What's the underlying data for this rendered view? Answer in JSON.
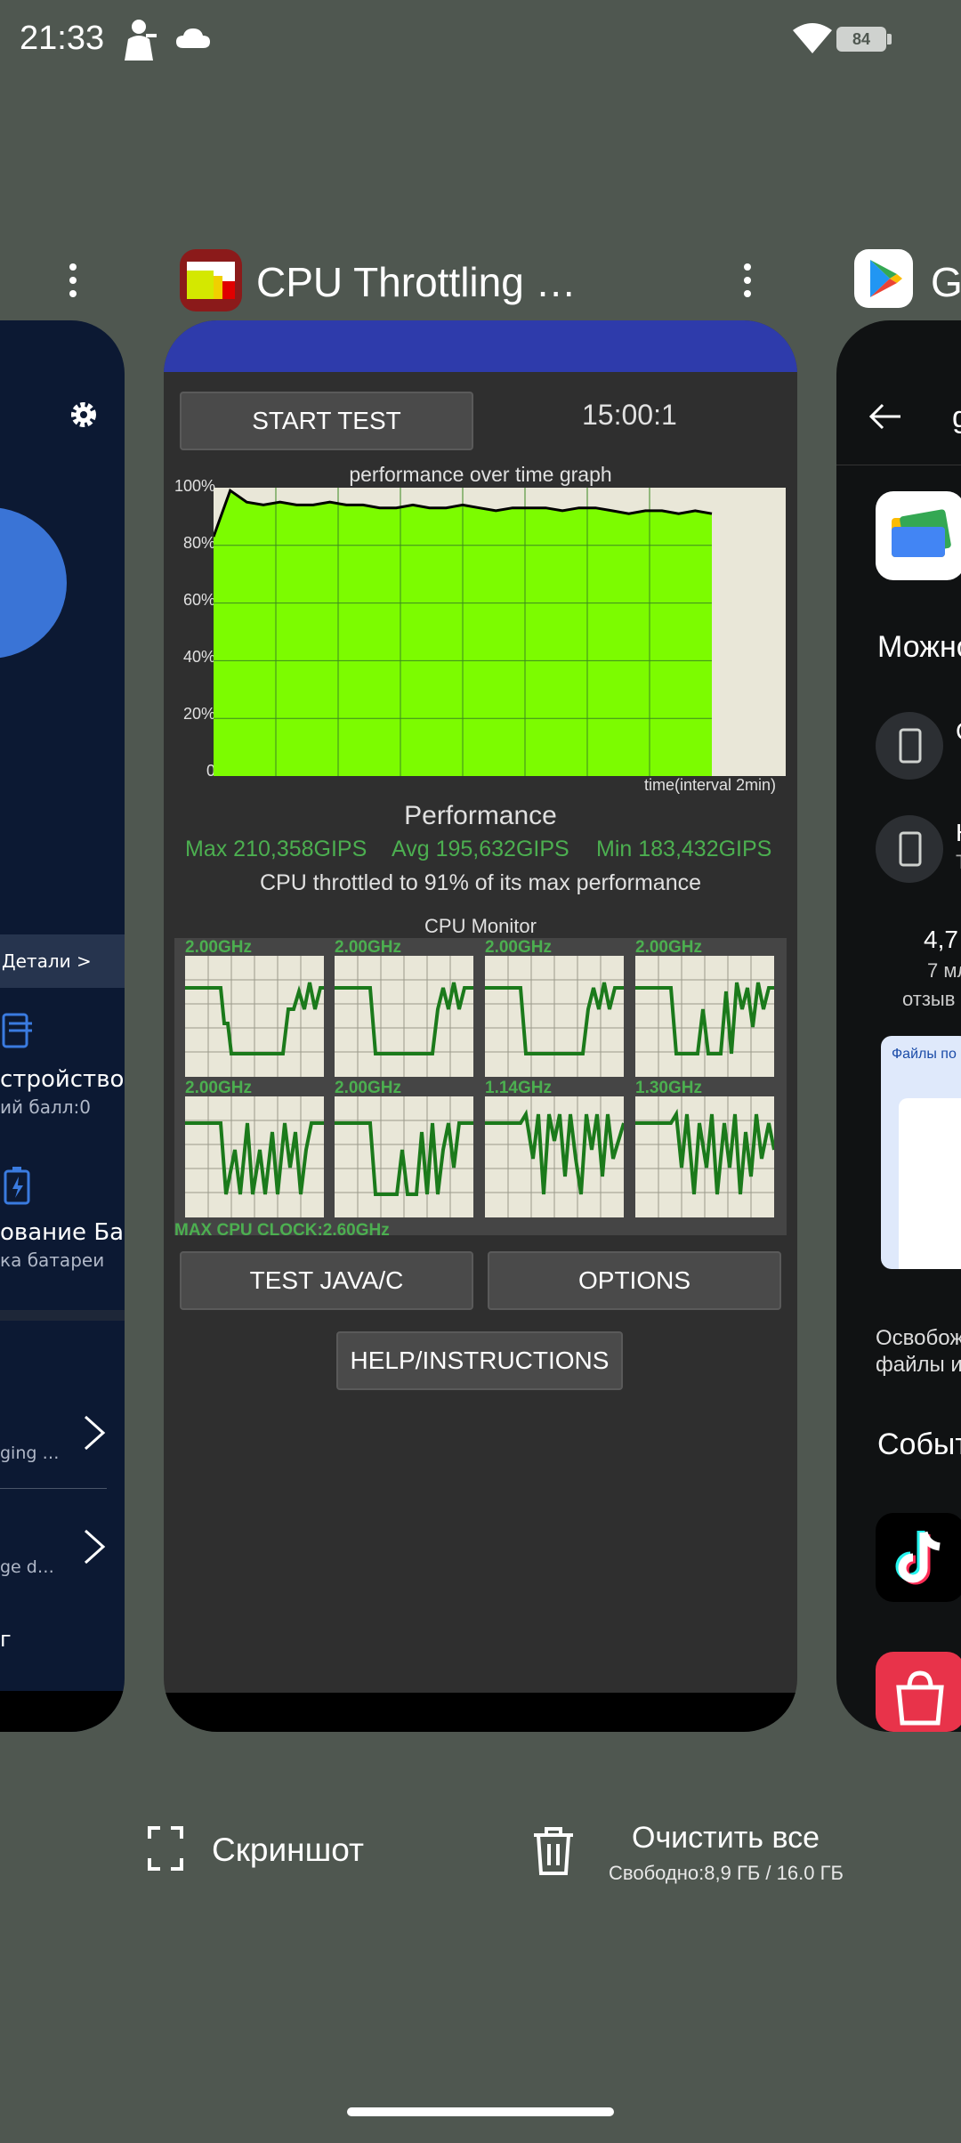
{
  "status_bar": {
    "time": "21:33",
    "battery": "84",
    "icons": [
      "pubg-icon",
      "cloud-icon",
      "wifi-icon",
      "battery-icon"
    ]
  },
  "left_app": {
    "details_label": "Детали >",
    "row1_title": "стройство",
    "row1_sub": "ий балл:0",
    "row2_title": "ование Ба…",
    "row2_sub": "ка батареи",
    "item1_sub": "ging …",
    "item2_sub": "ge d…",
    "item3_label": "г"
  },
  "main_app": {
    "title": "CPU Throttling …",
    "start_button": "START TEST",
    "timer": "15:00:1",
    "graph_title": "performance over time graph",
    "y_labels": [
      "100%",
      "80%",
      "60%",
      "40%",
      "20%",
      "0"
    ],
    "graph_footer": "time(interval 2min)",
    "performance_label": "Performance",
    "max": "Max 210,358GIPS",
    "avg": "Avg 195,632GIPS",
    "min": "Min 183,432GIPS",
    "throttle_text": "CPU throttled to 91% of its max performance",
    "cpu_monitor_title": "CPU Monitor",
    "cores": [
      "2.00GHz",
      "2.00GHz",
      "2.00GHz",
      "2.00GHz",
      "2.00GHz",
      "2.00GHz",
      "1.14GHz",
      "1.30GHz"
    ],
    "max_clock": "MAX CPU CLOCK:2.60GHz",
    "test_java_button": "TEST JAVA/C",
    "options_button": "OPTIONS",
    "help_button": "HELP/INSTRUCTIONS"
  },
  "right_app": {
    "header_letter": "G",
    "back_letter": "g",
    "section1": "Можно",
    "item1": "С",
    "item2": "Н",
    "item2_sub": "Т",
    "rating": "4,7",
    "downloads": "7 мл",
    "reviews": "отзыв",
    "promo_title": "Файлы по ка",
    "promo_caption1": "Освобож",
    "promo_caption2": "файлы и д",
    "section2": "Событ"
  },
  "bottom": {
    "screenshot_label": "Скриншот",
    "clear_label": "Очистить все",
    "storage": "Свободно:8,9 ГБ / 16.0 ГБ"
  },
  "chart_data": {
    "type": "area",
    "title": "performance over time graph",
    "xlabel": "time(interval 2min)",
    "ylabel": "",
    "ylim": [
      0,
      100
    ],
    "y_ticks": [
      "0",
      "20%",
      "40%",
      "60%",
      "80%",
      "100%"
    ],
    "x": [
      0,
      1,
      2,
      3,
      4,
      5,
      6,
      7,
      8,
      9,
      10,
      11,
      12,
      13,
      14,
      15,
      16,
      17,
      18,
      19,
      20,
      21,
      22,
      23,
      24,
      25,
      26,
      27,
      28,
      29,
      30
    ],
    "values": [
      83,
      99,
      95,
      94,
      95,
      94,
      94,
      95,
      94,
      94,
      93,
      93,
      94,
      93,
      93,
      94,
      93,
      92,
      93,
      93,
      93,
      92,
      93,
      93,
      92,
      91,
      92,
      92,
      91,
      92,
      91
    ],
    "grid": true,
    "colors": {
      "fill": "#7cfc00",
      "line": "#000000",
      "background": "#e9e7d8"
    }
  }
}
